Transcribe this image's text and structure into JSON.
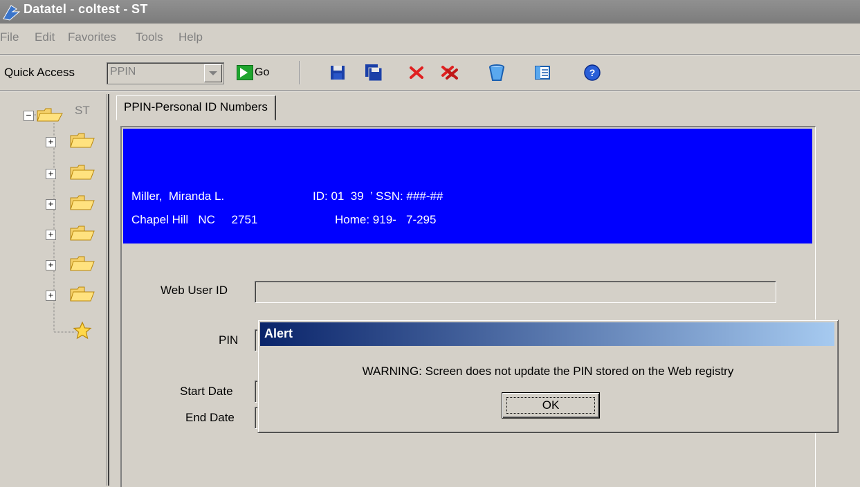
{
  "window": {
    "title": "Datatel - coltest - ST"
  },
  "menu": [
    "File",
    "Edit",
    "Favorites",
    "Tools",
    "Help"
  ],
  "toolbar": {
    "quick_access_label": "Quick Access",
    "quick_access_value": "PPIN",
    "go_label": "Go",
    "icons": [
      "save-icon",
      "save-all-icon",
      "cancel-icon",
      "cancel-all-icon",
      "delete-icon",
      "detail-icon",
      "help-icon"
    ]
  },
  "tree": {
    "root_label": "ST",
    "child_count": 6
  },
  "tab": {
    "label": "PPIN-Personal ID Numbers"
  },
  "header": {
    "name": "Miller,  Miranda L.",
    "id": "ID: 01  39  ’ SSN: ###-##",
    "city": "Chapel Hill   NC     2751",
    "home": "Home: 919-   7-295"
  },
  "form": {
    "web_user_id_label": "Web User ID",
    "pin_label": "PIN",
    "start_date_label": "Start Date",
    "end_date_label": "End Date"
  },
  "alert": {
    "title": "Alert",
    "message": "WARNING: Screen does not update the PIN stored on the Web registry",
    "ok_label": "OK"
  },
  "colors": {
    "header_band": "#0000ff",
    "window_bg": "#d4d0c8",
    "alert_title_start": "#0a246a",
    "alert_title_end": "#a6caf0"
  }
}
